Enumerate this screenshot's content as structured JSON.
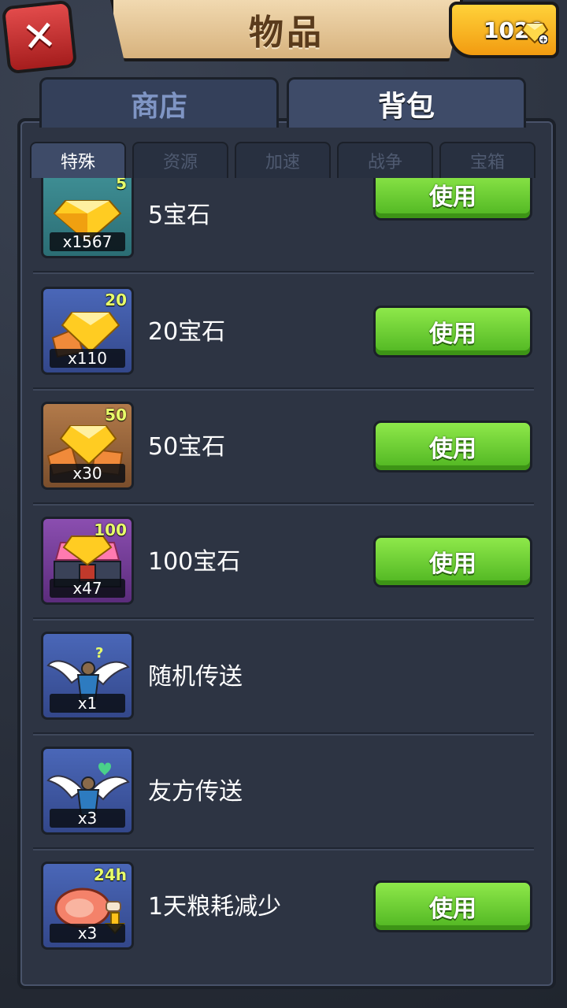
{
  "header": {
    "title": "物品",
    "close_icon": "close-x-icon",
    "gems": "1029"
  },
  "tabs": [
    {
      "label": "商店"
    },
    {
      "label": "背包"
    }
  ],
  "subtabs": [
    {
      "label": "特殊"
    },
    {
      "label": "资源"
    },
    {
      "label": "加速"
    },
    {
      "label": "战争"
    },
    {
      "label": "宝箱"
    }
  ],
  "items": [
    {
      "name": "5宝石",
      "badge": "5",
      "count": "x1567",
      "button": "使用",
      "icon": "gem-pile-icon"
    },
    {
      "name": "20宝石",
      "badge": "20",
      "count": "x110",
      "button": "使用",
      "icon": "gem-pile-icon"
    },
    {
      "name": "50宝石",
      "badge": "50",
      "count": "x30",
      "button": "使用",
      "icon": "gem-pile-icon"
    },
    {
      "name": "100宝石",
      "badge": "100",
      "count": "x47",
      "button": "使用",
      "icon": "gem-chest-icon"
    },
    {
      "name": "随机传送",
      "badge": "",
      "count": "x1",
      "button": "",
      "icon": "winged-teleport-icon"
    },
    {
      "name": "友方传送",
      "badge": "",
      "count": "x3",
      "button": "",
      "icon": "winged-teleport-icon"
    },
    {
      "name": "1天粮耗减少",
      "badge": "24h",
      "count": "x3",
      "button": "使用",
      "icon": "meat-icon"
    }
  ],
  "colors": {
    "button_green": "#5cc52a",
    "badge_yellow": "#e8ff6a",
    "gem_gold": "#ffcc22"
  }
}
